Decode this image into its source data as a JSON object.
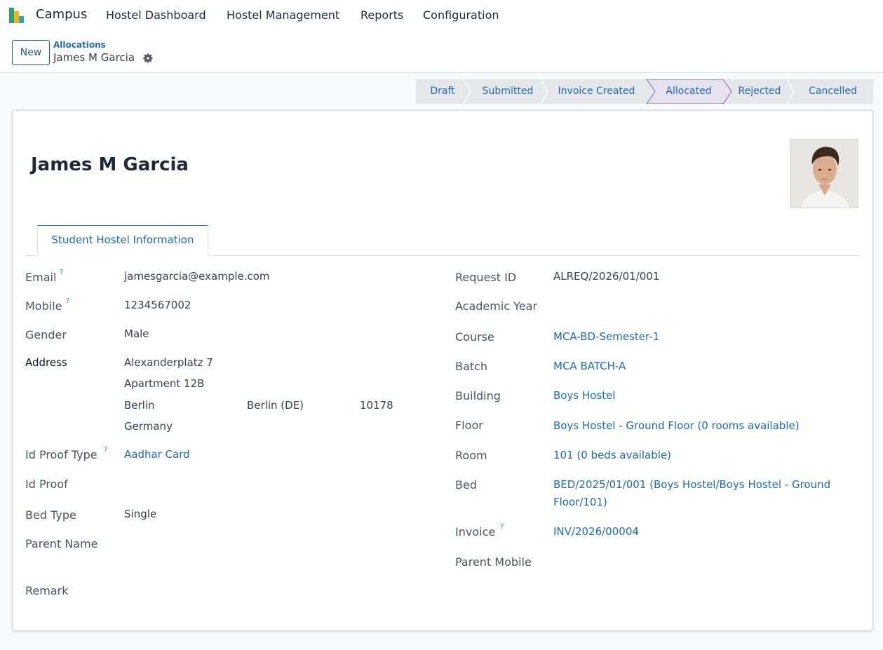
{
  "navbar": {
    "app_name": "Campus",
    "menu": [
      "Hostel Dashboard",
      "Hostel Management",
      "Reports",
      "Configuration"
    ]
  },
  "control": {
    "new_label": "New",
    "breadcrumb_parent": "Allocations",
    "breadcrumb_current": "James M Garcia"
  },
  "statusbar": {
    "stages": [
      "Draft",
      "Submitted",
      "Invoice Created",
      "Allocated",
      "Rejected",
      "Cancelled"
    ],
    "active": "Allocated"
  },
  "record": {
    "name": "James M Garcia",
    "tab_label": "Student Hostel Information"
  },
  "left_fields": {
    "email_label": "Email",
    "email_value": "jamesgarcia@example.com",
    "mobile_label": "Mobile",
    "mobile_value": "1234567002",
    "gender_label": "Gender",
    "gender_value": "Male",
    "address_label": "Address",
    "street": "Alexanderplatz 7",
    "street2": "Apartment 12B",
    "city": "Berlin",
    "state": "Berlin (DE)",
    "zip": "10178",
    "country": "Germany",
    "id_proof_type_label": "Id Proof Type",
    "id_proof_type_value": "Aadhar Card",
    "id_proof_label": "Id Proof",
    "bed_type_label": "Bed Type",
    "bed_type_value": "Single",
    "parent_name_label": "Parent Name",
    "remark_label": "Remark"
  },
  "right_fields": {
    "request_id_label": "Request ID",
    "request_id_value": "ALREQ/2026/01/001",
    "academic_year_label": "Academic Year",
    "course_label": "Course",
    "course_value": "MCA-BD-Semester-1",
    "batch_label": "Batch",
    "batch_value": "MCA BATCH-A",
    "building_label": "Building",
    "building_value": "Boys Hostel",
    "floor_label": "Floor",
    "floor_value": "Boys Hostel - Ground Floor (0 rooms available)",
    "room_label": "Room",
    "room_value": "101 (0 beds available)",
    "bed_label": "Bed",
    "bed_value_line1": "BED/2025/01/001 (Boys Hostel/Boys Hostel - Ground",
    "bed_value_line2": "Floor/101)",
    "invoice_label": "Invoice",
    "invoice_value": "INV/2026/00004",
    "parent_mobile_label": "Parent Mobile"
  },
  "help_mark": "?"
}
